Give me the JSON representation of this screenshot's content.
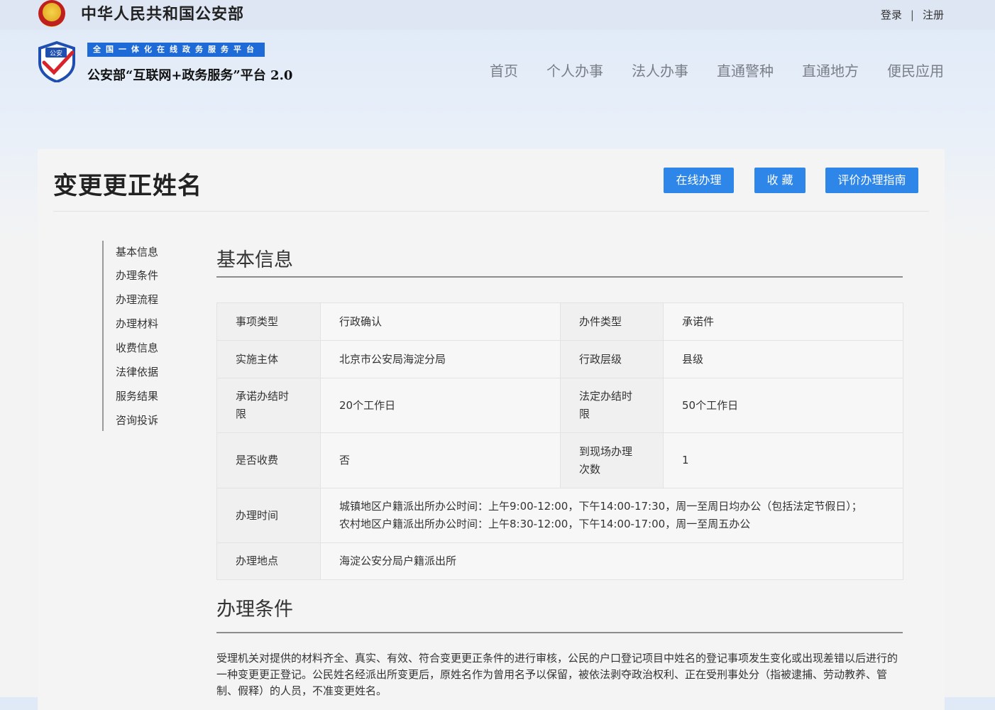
{
  "header": {
    "site_name": "中华人民共和国公安部",
    "login": "登录",
    "separator": "|",
    "register": "注册",
    "shield_text": "公安",
    "platform_tag": "全国一体化在线政务服务平台",
    "platform_name": "公安部“互联网+政务服务”平台 2.0"
  },
  "nav": [
    "首页",
    "个人办事",
    "法人办事",
    "直通警种",
    "直通地方",
    "便民应用"
  ],
  "page": {
    "title": "变更更正姓名",
    "buttons": {
      "online": "在线办理",
      "favorite": "收 藏",
      "evaluate": "评价办理指南"
    }
  },
  "sidebar": [
    "基本信息",
    "办理条件",
    "办理流程",
    "办理材料",
    "收费信息",
    "法律依据",
    "服务结果",
    "咨询投诉"
  ],
  "basic_info": {
    "title": "基本信息",
    "rows": [
      {
        "k1": "事项类型",
        "v1": "行政确认",
        "k2": "办件类型",
        "v2": "承诺件"
      },
      {
        "k1": "实施主体",
        "v1": "北京市公安局海淀分局",
        "k2": "行政层级",
        "v2": "县级"
      },
      {
        "k1": "承诺办结时限",
        "v1": "20个工作日",
        "k2": "法定办结时限",
        "v2": "50个工作日"
      },
      {
        "k1": "是否收费",
        "v1": "否",
        "k2": "到现场办理次数",
        "v2": "1"
      }
    ],
    "office_hours_label": "办理时间",
    "office_hours": [
      "城镇地区户籍派出所办公时间：上午9:00-12:00，下午14:00-17:30，周一至周日均办公（包括法定节假日）；",
      "农村地区户籍派出所办公时间：上午8:30-12:00，下午14:00-17:00，周一至周五办公"
    ],
    "location_label": "办理地点",
    "location": "海淀公安分局户籍派出所"
  },
  "conditions": {
    "title": "办理条件",
    "text": "受理机关对提供的材料齐全、真实、有效、符合变更更正条件的进行审核，公民的户口登记项目中姓名的登记事项发生变化或出现差错以后进行的一种变更更正登记。公民姓名经派出所变更后，原姓名作为曾用名予以保留，被依法剥夺政治权利、正在受刑事处分（指被逮捕、劳动教养、管制、假释）的人员，不准变更姓名。"
  }
}
